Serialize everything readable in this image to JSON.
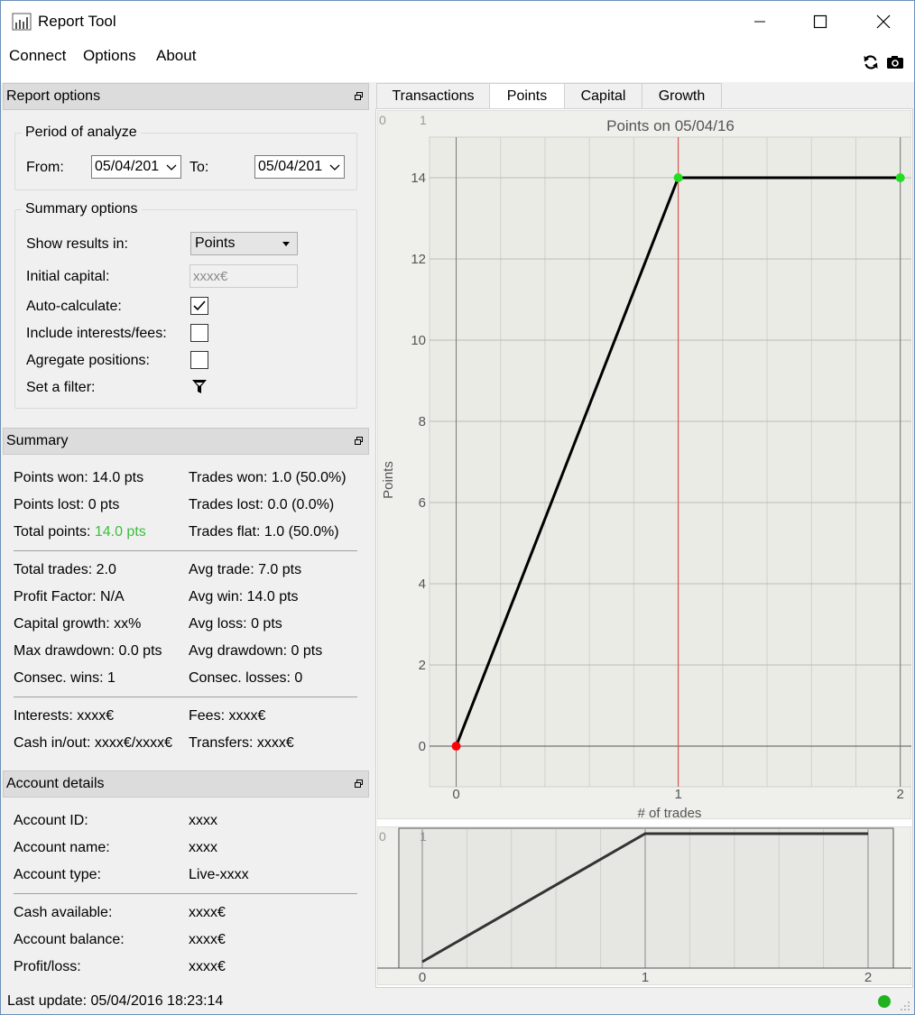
{
  "window": {
    "title": "Report Tool"
  },
  "menu": {
    "connect": "Connect",
    "options": "Options",
    "about": "About"
  },
  "report_options": {
    "header": "Report options",
    "period": {
      "title": "Period of analyze",
      "from_label": "From:",
      "from_value": "05/04/201",
      "to_label": "To:",
      "to_value": "05/04/201"
    },
    "summary_options": {
      "title": "Summary options",
      "show_results_label": "Show results in:",
      "show_results_value": "Points",
      "initial_capital_label": "Initial capital:",
      "initial_capital_placeholder": "xxxx€",
      "auto_calculate_label": "Auto-calculate:",
      "auto_calculate_checked": true,
      "include_fees_label": "Include interests/fees:",
      "include_fees_checked": false,
      "aggregate_label": "Agregate positions:",
      "aggregate_checked": false,
      "filter_label": "Set a filter:"
    }
  },
  "summary": {
    "header": "Summary",
    "points_won": "Points won: 14.0 pts",
    "trades_won": "Trades won: 1.0 (50.0%)",
    "points_lost": "Points lost: 0 pts",
    "trades_lost": "Trades lost: 0.0 (0.0%)",
    "total_points_label": "Total points: ",
    "total_points_value": "14.0 pts",
    "trades_flat": "Trades flat: 1.0 (50.0%)",
    "total_trades": "Total trades: 2.0",
    "avg_trade": "Avg trade: 7.0 pts",
    "profit_factor": "Profit Factor: N/A",
    "avg_win": "Avg win: 14.0 pts",
    "capital_growth": "Capital growth: xx%",
    "avg_loss": "Avg loss: 0 pts",
    "max_drawdown": "Max drawdown: 0.0 pts",
    "avg_drawdown": "Avg drawdown: 0 pts",
    "consec_wins": "Consec. wins: 1",
    "consec_losses": "Consec. losses: 0",
    "interests": "Interests: xxxx€",
    "fees": "Fees: xxxx€",
    "cash_inout": "Cash in/out: xxxx€/xxxx€",
    "transfers": "Transfers: xxxx€"
  },
  "account": {
    "header": "Account details",
    "id_label": "Account ID:",
    "id_value": "xxxx",
    "name_label": "Account name:",
    "name_value": "xxxx",
    "type_label": "Account type:",
    "type_value": "Live-xxxx",
    "cash_label": "Cash available:",
    "cash_value": "xxxx€",
    "balance_label": "Account balance:",
    "balance_value": "xxxx€",
    "pl_label": "Profit/loss:",
    "pl_value": "xxxx€"
  },
  "status": {
    "last_update": "Last update: 05/04/2016 18:23:14",
    "connected_color": "#1fb41f"
  },
  "tabs": [
    "Transactions",
    "Points",
    "Capital",
    "Growth"
  ],
  "active_tab": "Points",
  "chart_data": {
    "type": "line",
    "title": "Points on 05/04/16",
    "xlabel": "# of trades",
    "ylabel": "Points",
    "x": [
      0,
      1,
      2
    ],
    "y": [
      0,
      14,
      14
    ],
    "xlim": [
      -0.12,
      2.05
    ],
    "ylim": [
      -1,
      15
    ],
    "xticks": [
      0,
      1,
      2
    ],
    "yticks": [
      0,
      2,
      4,
      6,
      8,
      10,
      12,
      14
    ],
    "grid": true,
    "marker_colors": [
      "#ff0000",
      "#22dd22",
      "#22dd22"
    ],
    "line_color": "#000000",
    "cursor_x": 1,
    "cursor_color": "#e05050",
    "overview": {
      "x": [
        0,
        1,
        2
      ],
      "y": [
        0,
        14,
        14
      ],
      "xticks": [
        0,
        1,
        2
      ]
    }
  },
  "icons": {
    "refresh": "refresh-icon",
    "camera": "camera-icon",
    "filter": "filter-icon"
  }
}
